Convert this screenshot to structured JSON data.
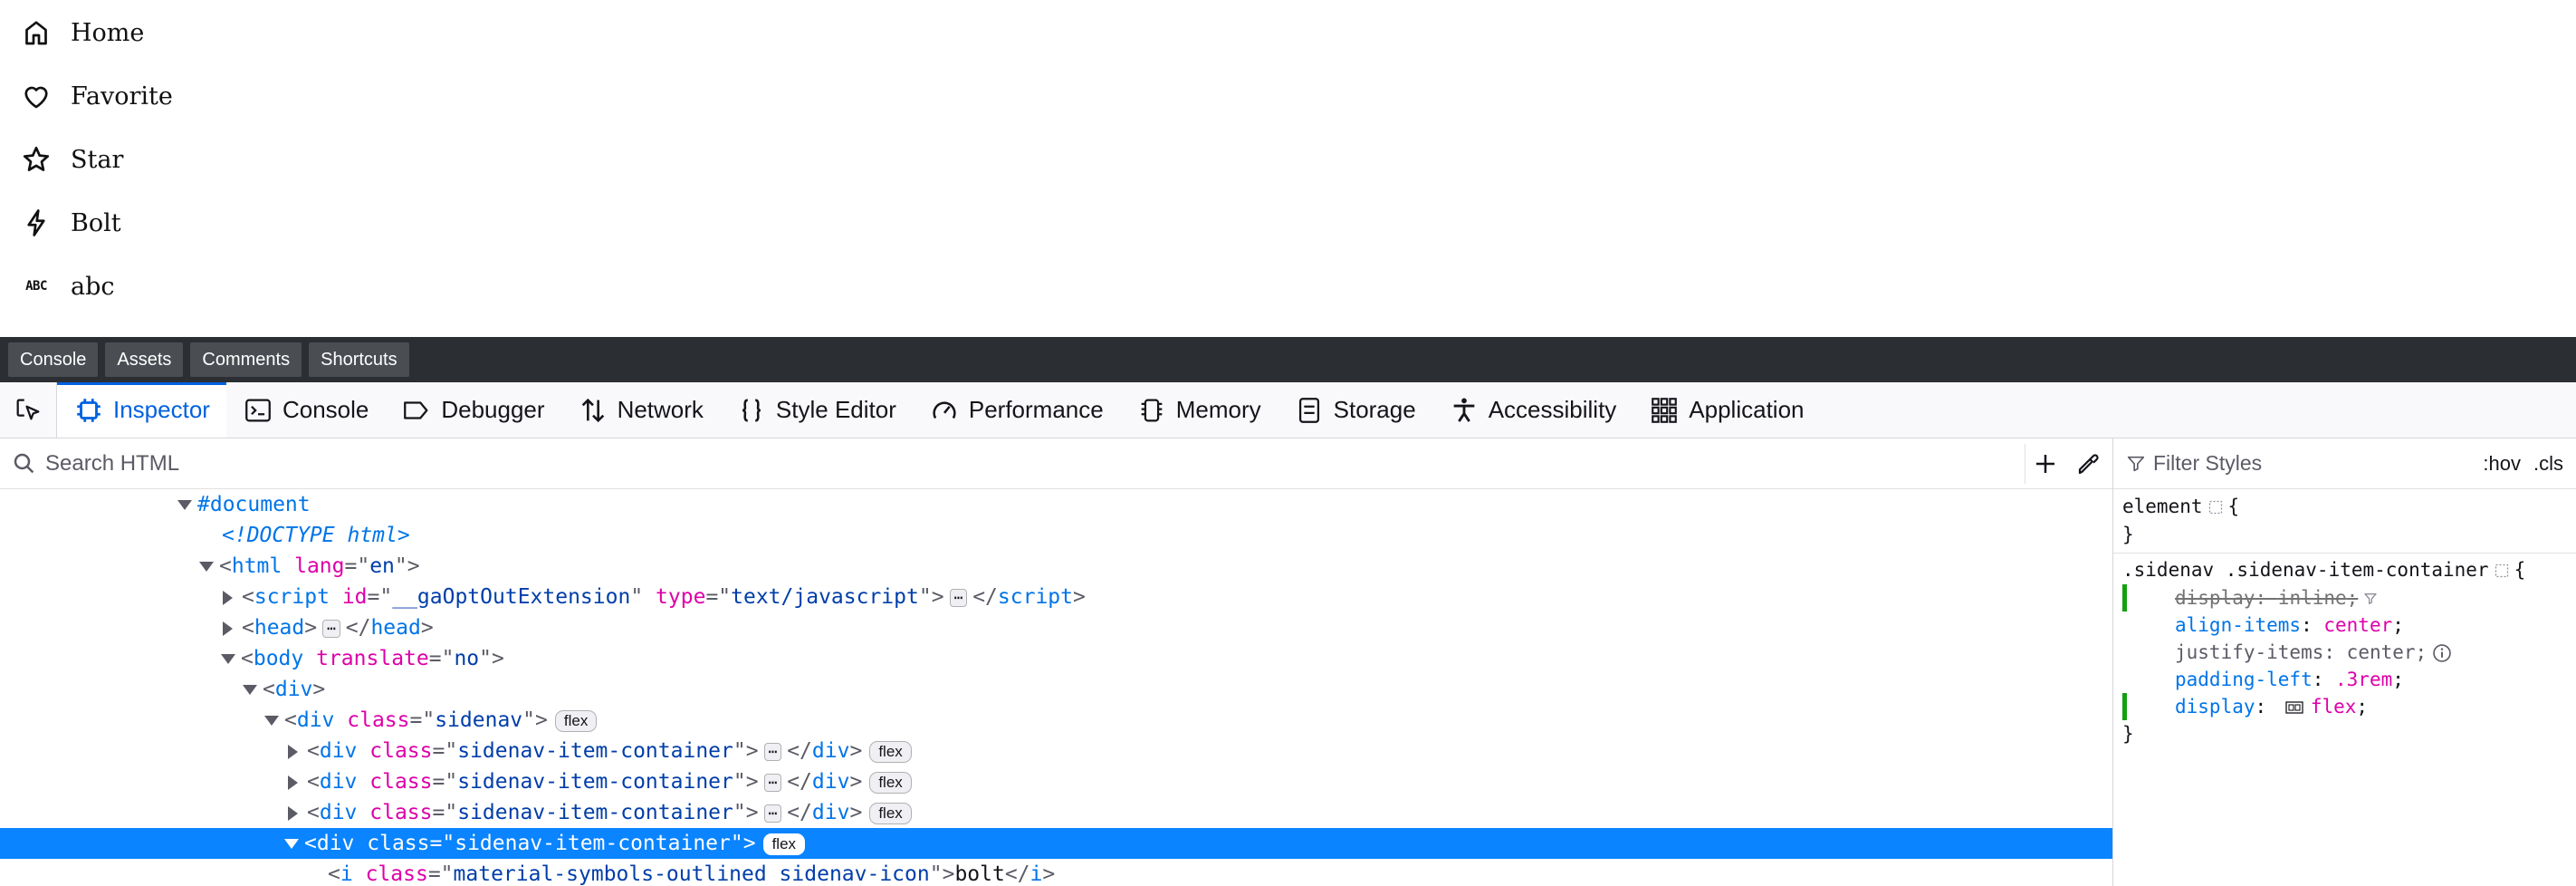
{
  "sidenav": {
    "items": [
      {
        "label": "Home",
        "icon": "home-icon"
      },
      {
        "label": "Favorite",
        "icon": "heart-icon"
      },
      {
        "label": "Star",
        "icon": "star-icon"
      },
      {
        "label": "Bolt",
        "icon": "bolt-icon"
      },
      {
        "label": "abc",
        "icon_text": "ABC"
      }
    ]
  },
  "darkbar": {
    "buttons": [
      "Console",
      "Assets",
      "Comments",
      "Shortcuts"
    ]
  },
  "devtools": {
    "tabs": [
      "Inspector",
      "Console",
      "Debugger",
      "Network",
      "Style Editor",
      "Performance",
      "Memory",
      "Storage",
      "Accessibility",
      "Application"
    ],
    "selected_tab": "Inspector",
    "accent_color": "#0061e0",
    "search_placeholder": "Search HTML",
    "markup": {
      "document": "#document",
      "doctype": "<!DOCTYPE html>",
      "html_tag": "html",
      "html_attr": "lang",
      "html_val": "en",
      "script_tag": "script",
      "script_attr1": "id",
      "script_val1": "__gaOptOutExtension",
      "script_attr2": "type",
      "script_val2": "text/javascript",
      "head_tag": "head",
      "body_tag": "body",
      "body_attr": "translate",
      "body_val": "no",
      "div_tag": "div",
      "class_attr": "class",
      "sidenav_val": "sidenav",
      "container_val": "sidenav-item-container",
      "i_tag": "i",
      "i_class_val": "material-symbols-outlined sidenav-icon",
      "i_text": "bolt",
      "ellipsis": "⋯",
      "badge": "flex",
      "selected_bg": "#0a84ff"
    },
    "rules": {
      "filter_placeholder": "Filter Styles",
      "hov": ":hov",
      "cls": ".cls",
      "element_selector": "element",
      "open_brace": "{",
      "close_brace": "}",
      "selector2": ".sidenav .sidenav-item-container",
      "decls": [
        {
          "prop": "display",
          "value": "inline",
          "overridden": true
        },
        {
          "prop": "align-items",
          "value": "center"
        },
        {
          "prop": "justify-items",
          "value": "center",
          "inactive": true
        },
        {
          "prop": "padding-left",
          "value": ".3rem"
        },
        {
          "prop": "display",
          "value": "flex"
        }
      ]
    }
  }
}
